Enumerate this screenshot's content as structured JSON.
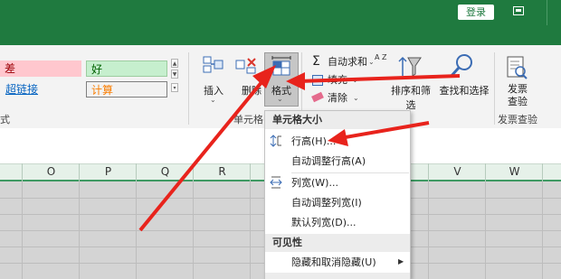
{
  "titlebar": {
    "login_label": "登录",
    "background_color": "#1f7a3f"
  },
  "ribbon": {
    "styles": {
      "bad": "差",
      "good": "好",
      "hyperlink": "超链接",
      "calc": "计算",
      "group_label": "式"
    },
    "cells": {
      "insert_label": "插入",
      "delete_label": "删除",
      "format_label": "格式",
      "group_label": "单元格"
    },
    "editing": {
      "autosum_label": "自动求和",
      "fill_label": "填充",
      "clear_label": "清除",
      "az_label": "A Z",
      "sort_filter_label": "排序和筛选",
      "find_select_label": "查找和选择"
    },
    "invoice": {
      "label": "发票查验",
      "group_label": "发票查验"
    }
  },
  "columns": [
    "O",
    "P",
    "Q",
    "R",
    "",
    "V",
    "W"
  ],
  "format_menu": {
    "section_cell_size": "单元格大小",
    "row_height": "行高(H)...",
    "autofit_row_height": "自动调整行高(A)",
    "column_width": "列宽(W)...",
    "autofit_column_width": "自动调整列宽(I)",
    "default_width": "默认列宽(D)...",
    "section_visibility": "可见性",
    "hide_unhide": "隐藏和取消隐藏(U)"
  },
  "colors": {
    "arrow": "#e8231c",
    "selected_button": "#c6c6c6",
    "accent_green": "#3f9a63"
  },
  "icons": {
    "insert": "insert-cells-icon",
    "delete": "delete-cells-icon",
    "format": "format-cells-icon",
    "autosum": "sigma-icon",
    "fill": "fill-down-icon",
    "clear": "eraser-icon",
    "sort": "sort-filter-icon",
    "find": "magnifier-icon",
    "invoice": "invoice-check-icon",
    "row_height": "row-height-icon",
    "column_width": "column-width-icon"
  }
}
